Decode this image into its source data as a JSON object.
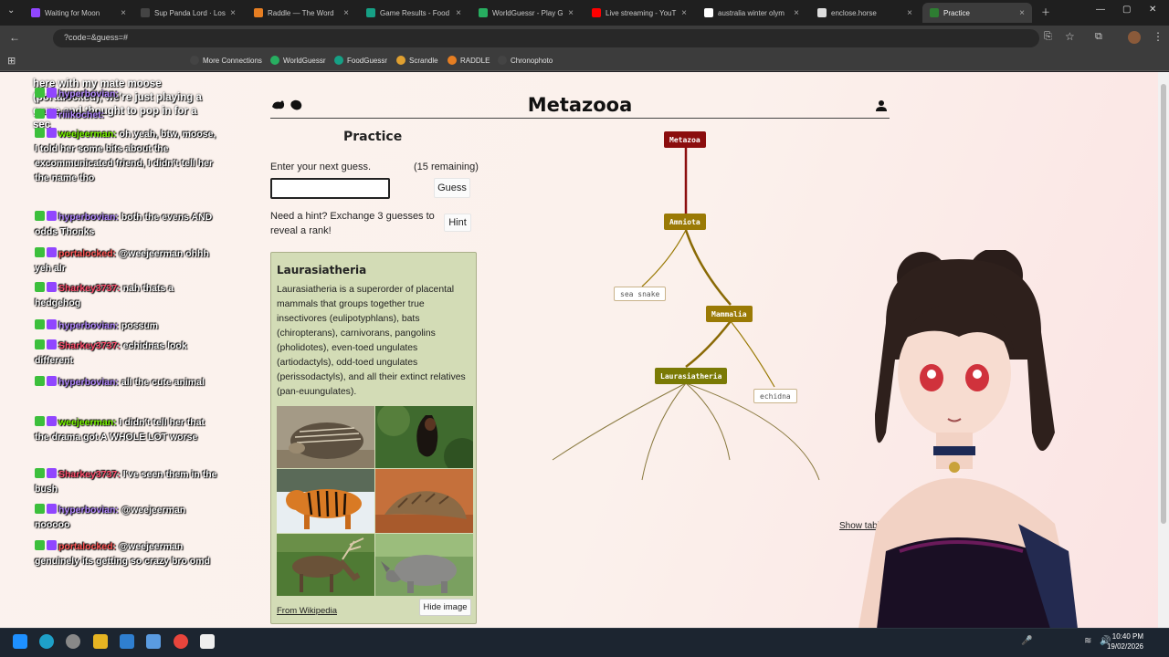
{
  "browser": {
    "tabs": [
      {
        "label": "Waiting for Moon",
        "color": "#9146ff"
      },
      {
        "label": "Sup Panda Lord · Los",
        "color": "#444"
      },
      {
        "label": "Raddle — The Word",
        "color": "#e67e22"
      },
      {
        "label": "Game Results - Food",
        "color": "#16a085"
      },
      {
        "label": "WorldGuessr - Play G",
        "color": "#27ae60"
      },
      {
        "label": "Live streaming - YouT",
        "color": "#ff0000"
      },
      {
        "label": "australia winter olym",
        "color": "#ffffff"
      },
      {
        "label": "enclose.horse",
        "color": "#dddddd"
      },
      {
        "label": "Practice",
        "color": "#2e7d32"
      }
    ],
    "address": "?code=&guess=#",
    "bookmarks": [
      {
        "label": "More Connections",
        "color": "#444"
      },
      {
        "label": "WorldGuessr",
        "color": "#27ae60"
      },
      {
        "label": "FoodGuessr",
        "color": "#16a085"
      },
      {
        "label": "Scrandle",
        "color": "#e0a030"
      },
      {
        "label": "RADDLE",
        "color": "#e67e22"
      },
      {
        "label": "Chronophoto",
        "color": "#444"
      }
    ]
  },
  "chat": {
    "top_message": "here with my mate moose (portalocked), we're just playing a game and thought to pop in for a sec",
    "messages": [
      {
        "user": "hyperbovian:",
        "text": "",
        "color": "#b388ff"
      },
      {
        "user": "riiikochet:",
        "text": "",
        "color": "#b388ff"
      },
      {
        "user": "weejeerman:",
        "text": "oh yeah, btw, moose, I told her some bits about the excommunicated friend, I didn't tell her the name tho",
        "color": "#7cfc00"
      },
      {
        "user": "hyperbovian:",
        "text": "both the evens AND odds Thonks",
        "color": "#b388ff"
      },
      {
        "user": "portalocked:",
        "text": "@weejeerman ohhh yeh alr",
        "color": "#ff5555"
      },
      {
        "user": "Sharkey3737:",
        "text": "nah thats a hedgehog",
        "color": "#ff4d6d"
      },
      {
        "user": "hyperbovian:",
        "text": "possum",
        "color": "#b388ff"
      },
      {
        "user": "Sharkey3737:",
        "text": "echidnas look different",
        "color": "#ff4d6d"
      },
      {
        "user": "hyperbovian:",
        "text": "all the cute animal",
        "color": "#b388ff"
      },
      {
        "user": "weejeerman:",
        "text": "I didn't tell her that the drama got A WHOLE LOT worse",
        "color": "#7cfc00"
      },
      {
        "user": "Sharkey3737:",
        "text": "I've seen them in the bush",
        "color": "#ff4d6d"
      },
      {
        "user": "hyperbovian:",
        "text": "@weejeerman nooooo",
        "color": "#b388ff"
      },
      {
        "user": "portalocked:",
        "text": "@weejeerman genuinely its getting so crazy bro omd",
        "color": "#ff5555"
      }
    ]
  },
  "game": {
    "title": "Metazooa",
    "mode": "Practice",
    "prompt": "Enter your next guess.",
    "remaining": "(15 remaining)",
    "guess_value": "",
    "guess_button": "Guess",
    "hint_text": "Need a hint? Exchange 3 guesses to reveal a rank!",
    "hint_button": "Hint",
    "show_table": "Show table",
    "card": {
      "title": "Laurasiatheria",
      "description": "Laurasiatheria is a superorder of placental mammals that groups together true insectivores (eulipotyphlans), bats (chiropterans), carnivorans, pangolins (pholidotes), even-toed ungulates (artiodactyls), odd-toed ungulates (perissodactyls), and all their extinct relatives (pan-euungulates).",
      "images": [
        "hedgehog",
        "bat",
        "tiger",
        "pangolin",
        "deer",
        "rhinoceros"
      ],
      "link": "From Wikipedia",
      "hide_button": "Hide image"
    },
    "tree": {
      "nodes": [
        {
          "label": "Metazoa",
          "kind": "main",
          "color": "#8b0d0d"
        },
        {
          "label": "Amniota",
          "kind": "main",
          "color": "#9a7a05"
        },
        {
          "label": "Mammalia",
          "kind": "main",
          "color": "#9a7a05"
        },
        {
          "label": "Laurasiatheria",
          "kind": "main",
          "color": "#7a7a05"
        },
        {
          "label": "sea snake",
          "kind": "guess"
        },
        {
          "label": "echidna",
          "kind": "guess"
        }
      ]
    }
  },
  "taskbar": {
    "time": "10:40 PM",
    "date": "19/02/2026"
  }
}
